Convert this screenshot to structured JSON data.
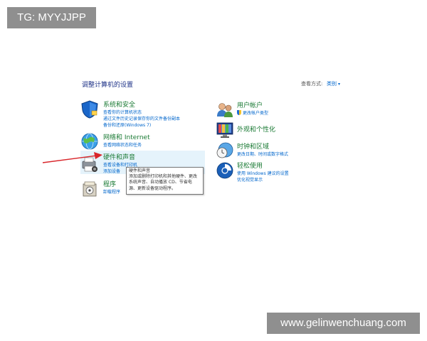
{
  "watermark": {
    "top_left": "TG: MYYJJPP",
    "bottom_right": "www.gelinwenchuang.com"
  },
  "control_panel": {
    "title": "调整计算机的设置",
    "view_by_label": "查看方式:",
    "view_by_value": "类别"
  },
  "categories": {
    "system_security": {
      "title": "系统和安全",
      "links": [
        "查看你的计算机状态",
        "通过文件历史记录保存你的文件备份副本",
        "备份和还原(Windows 7)"
      ]
    },
    "network": {
      "title": "网络和 Internet",
      "links": [
        "查看网络状态和任务"
      ]
    },
    "hardware": {
      "title": "硬件和声音",
      "links": [
        "查看设备和打印机",
        "添加设备"
      ]
    },
    "programs": {
      "title": "程序",
      "links": [
        "卸载程序"
      ]
    },
    "user_accounts": {
      "title": "用户帐户",
      "links": [
        "更改帐户类型"
      ]
    },
    "appearance": {
      "title": "外观和个性化",
      "links": []
    },
    "clock_region": {
      "title": "时钟和区域",
      "links": [
        "更改日期、时间或数字格式"
      ]
    },
    "ease_access": {
      "title": "轻松使用",
      "links": [
        "使用 Windows 建议的设置",
        "优化视觉显示"
      ]
    }
  },
  "tooltip": {
    "title": "硬件和声音",
    "lines": [
      "添加或删除打印机和其他硬件、更改",
      "系统声音、自动播放 CD、节省电",
      "源、更新设备驱动程序。"
    ]
  },
  "colors": {
    "category_title": "#1a7a34",
    "link": "#0066cc",
    "title": "#1e3287",
    "hover_background": "#e5f3fb",
    "arrow": "#d9262b",
    "watermark_bg": "#8f8f8f"
  }
}
